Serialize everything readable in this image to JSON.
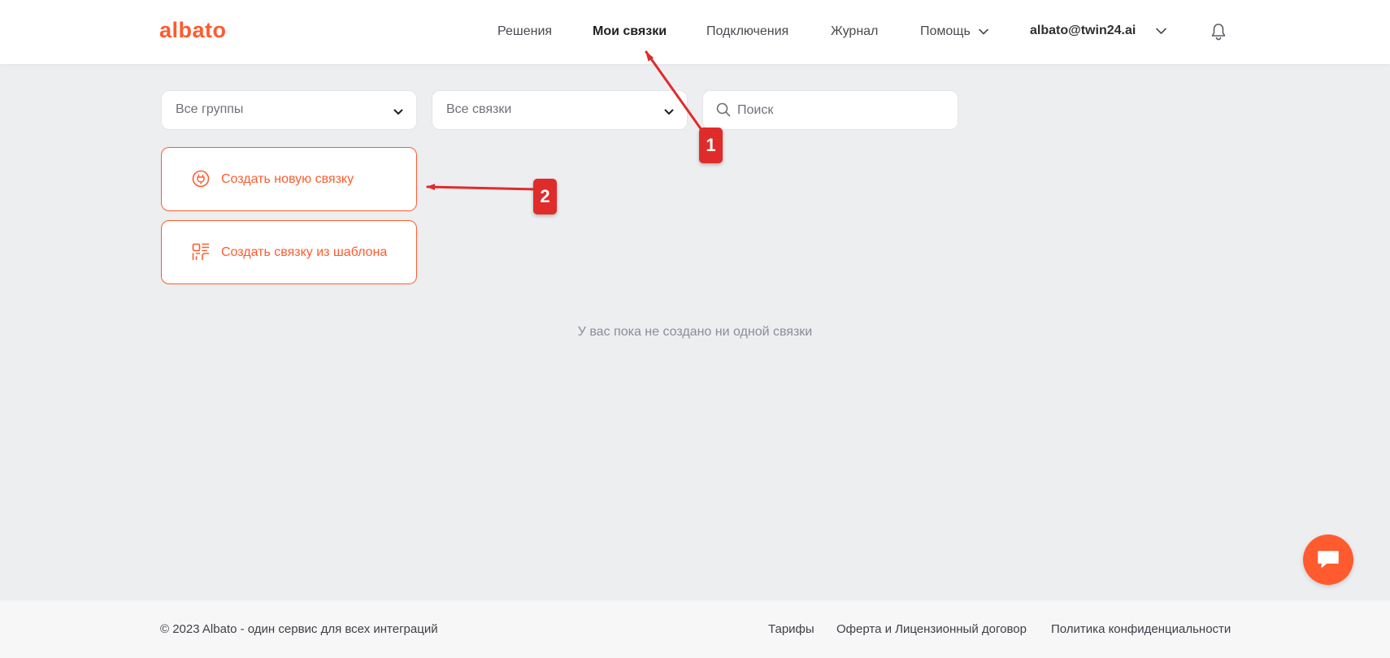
{
  "header": {
    "logo": "albato",
    "nav": {
      "solutions": "Решения",
      "my_bundles": "Мои связки",
      "connections": "Подключения",
      "journal": "Журнал",
      "help": "Помощь"
    },
    "user_email": "albato@twin24.ai"
  },
  "filters": {
    "groups_value": "Все группы",
    "bundles_value": "Все связки",
    "search_placeholder": "Поиск"
  },
  "actions": {
    "create_new": "Создать новую связку",
    "create_from_template": "Создать связку из шаблона"
  },
  "empty_state": "У вас пока не создано ни одной связки",
  "annotations": {
    "marker_1": "1",
    "marker_2": "2"
  },
  "footer": {
    "copyright": "© 2023 Albato - один сервис для всех интеграций",
    "links": {
      "tariffs": "Тарифы",
      "offer": "Оферта и Лицензионный договор",
      "privacy": "Политика конфиденциальности"
    }
  },
  "colors": {
    "accent": "#ff5b2e",
    "annotation": "#e02b2b",
    "background": "#edeef0"
  },
  "icons": {
    "help_dropdown": "chevron-down-icon",
    "user_dropdown": "chevron-down-icon",
    "notifications": "bell-icon",
    "search": "search-icon",
    "create_new": "plug-icon",
    "create_template": "template-grid-icon",
    "chat": "chat-icon"
  }
}
